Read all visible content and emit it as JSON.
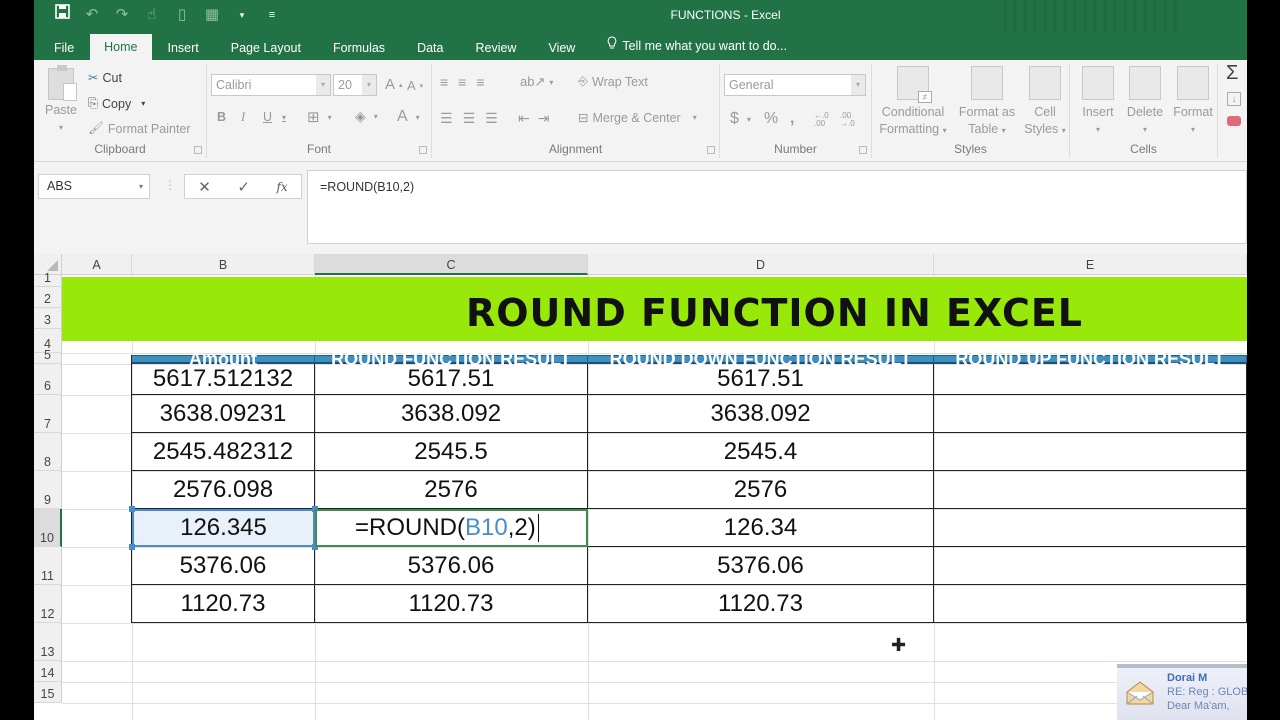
{
  "window": {
    "title": "FUNCTIONS - Excel"
  },
  "qat": {
    "icons": [
      "save-icon",
      "undo-icon",
      "redo-icon",
      "touch-mode-icon",
      "new-file-icon",
      "table-icon",
      "dropdown-icon",
      "customize-qat-icon"
    ]
  },
  "tabs": [
    {
      "label": "File"
    },
    {
      "label": "Home"
    },
    {
      "label": "Insert"
    },
    {
      "label": "Page Layout"
    },
    {
      "label": "Formulas"
    },
    {
      "label": "Data"
    },
    {
      "label": "Review"
    },
    {
      "label": "View"
    }
  ],
  "active_tab": "Home",
  "tell_me": "Tell me what you want to do...",
  "ribbon": {
    "clipboard": {
      "label": "Clipboard",
      "paste": "Paste",
      "cut": "Cut",
      "copy": "Copy",
      "format_painter": "Format Painter"
    },
    "font": {
      "label": "Font",
      "font_name": "Calibri",
      "font_size": "20",
      "bold": "B",
      "italic": "I",
      "underline": "U",
      "grow": "A",
      "shrink": "A",
      "color": "A"
    },
    "alignment": {
      "label": "Alignment",
      "wrap_text": "Wrap Text",
      "merge_center": "Merge & Center"
    },
    "number": {
      "label": "Number",
      "format": "General",
      "currency": "$",
      "percent": "%",
      "comma": ",",
      "inc_decimal": "←.0 .00",
      "dec_decimal": ".00 →.0"
    },
    "styles": {
      "label": "Styles",
      "conditional": "Conditional",
      "conditional2": "Formatting",
      "format_table": "Format as",
      "format_table2": "Table",
      "cell_styles": "Cell",
      "cell_styles2": "Styles"
    },
    "cells": {
      "label": "Cells",
      "insert": "Insert",
      "delete": "Delete",
      "format": "Format"
    },
    "editing": {
      "sum": "Σ"
    }
  },
  "formula_bar": {
    "name_box": "ABS",
    "cancel": "✕",
    "enter": "✓",
    "fx": "fx",
    "formula": "=ROUND(B10,2)"
  },
  "columns": [
    "A",
    "B",
    "C",
    "D",
    "E"
  ],
  "rows": [
    "1",
    "2",
    "3",
    "4",
    "5",
    "6",
    "7",
    "8",
    "9",
    "10",
    "11",
    "12",
    "13",
    "14",
    "15"
  ],
  "selected_column": "C",
  "selected_row": "10",
  "sheet": {
    "banner": "ROUND FUNCTION IN EXCEL",
    "banner_color": "#98e80a",
    "header_color": "#3f8fc1",
    "headers": [
      "Amount",
      "ROUND FUNCTION RESULT",
      "ROUND DOWN FUNCTION RESULT",
      "ROUND UP FUNCTION RESULT"
    ],
    "data": [
      [
        "5617.512132",
        "5617.51",
        "5617.51",
        ""
      ],
      [
        "3638.09231",
        "3638.092",
        "3638.092",
        ""
      ],
      [
        "2545.482312",
        "2545.5",
        "2545.4",
        ""
      ],
      [
        "2576.098",
        "2576",
        "2576",
        ""
      ],
      [
        "126.345",
        "",
        "126.34",
        ""
      ],
      [
        "5376.06",
        "5376.06",
        "5376.06",
        ""
      ],
      [
        "1120.73",
        "1120.73",
        "1120.73",
        ""
      ]
    ],
    "editing_cell": {
      "address": "C10",
      "prefix": "=ROUND(",
      "ref": "B10",
      "suffix": ",2)"
    }
  },
  "notification": {
    "from": "Dorai M",
    "subject": "RE: Reg : GLOB",
    "body": "Dear  Ma'am,"
  }
}
